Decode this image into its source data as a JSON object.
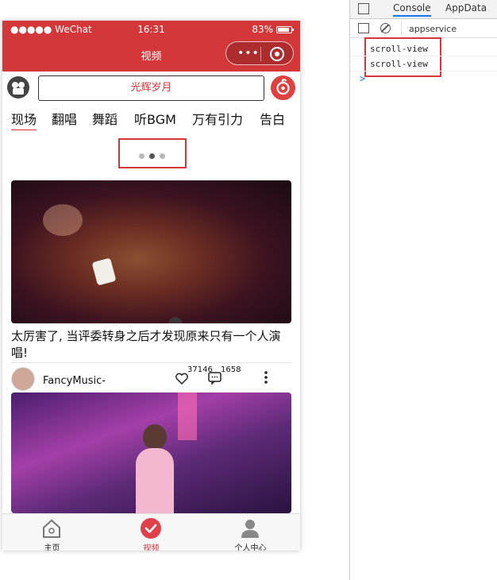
{
  "status_bar": {
    "signal": "●●●●● WeChat",
    "time": "16:31",
    "battery": "83%"
  },
  "nav": {
    "title": "视频"
  },
  "search": {
    "placeholder": "光辉岁月"
  },
  "tabs": [
    "现场",
    "翻唱",
    "舞蹈",
    "听BGM",
    "万有引力",
    "告白"
  ],
  "active_tab": "现场",
  "videos": [
    {
      "caption": "太厉害了, 当评委转身之后才发现原来只有一个人演唱!",
      "author": "FancyMusic-",
      "likes": "37146",
      "comments": "1658"
    }
  ],
  "tabbar": [
    {
      "label": "主页",
      "icon": "home-icon"
    },
    {
      "label": "视频",
      "icon": "video-check-icon"
    },
    {
      "label": "个人中心",
      "icon": "user-icon"
    }
  ],
  "colors": {
    "brand": "#d4373a",
    "highlight_box": "#d4373a",
    "devtools_accent": "#1a73e8"
  },
  "devtools": {
    "tabs": [
      "Console",
      "AppData"
    ],
    "active_tab": "Console",
    "context": "appservice",
    "logs": [
      "scroll-view",
      "scroll-view"
    ],
    "prompt": ">"
  }
}
